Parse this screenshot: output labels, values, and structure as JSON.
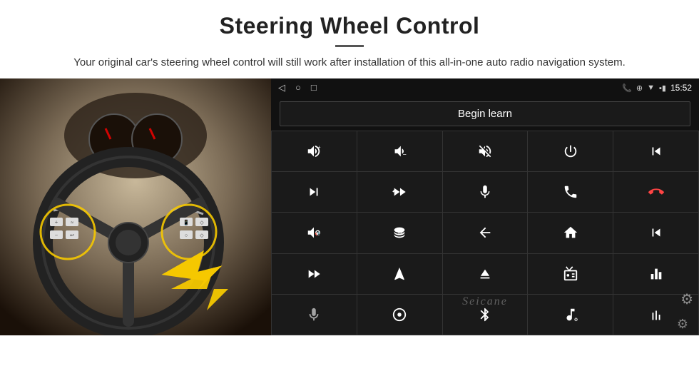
{
  "header": {
    "title": "Steering Wheel Control",
    "subtitle": "Your original car's steering wheel control will still work after installation of this all-in-one auto radio navigation system.",
    "divider": true
  },
  "statusbar": {
    "time": "15:52",
    "nav_icons": [
      "◁",
      "○",
      "□"
    ],
    "right_icons": [
      "📞",
      "⊕",
      "▼"
    ]
  },
  "begin_learn": {
    "label": "Begin learn"
  },
  "controls": [
    {
      "icon": "vol_up",
      "row": 1,
      "col": 1
    },
    {
      "icon": "vol_down",
      "row": 1,
      "col": 2
    },
    {
      "icon": "mute",
      "row": 1,
      "col": 3
    },
    {
      "icon": "power",
      "row": 1,
      "col": 4
    },
    {
      "icon": "prev_track",
      "row": 1,
      "col": 5
    },
    {
      "icon": "next",
      "row": 2,
      "col": 1
    },
    {
      "icon": "skip_fwd",
      "row": 2,
      "col": 2
    },
    {
      "icon": "mic",
      "row": 2,
      "col": 3
    },
    {
      "icon": "phone",
      "row": 2,
      "col": 4
    },
    {
      "icon": "hang_up",
      "row": 2,
      "col": 5
    },
    {
      "icon": "speaker",
      "row": 3,
      "col": 1
    },
    {
      "icon": "360",
      "row": 3,
      "col": 2
    },
    {
      "icon": "back",
      "row": 3,
      "col": 3
    },
    {
      "icon": "home",
      "row": 3,
      "col": 4
    },
    {
      "icon": "rewind",
      "row": 3,
      "col": 5
    },
    {
      "icon": "fast_fwd",
      "row": 4,
      "col": 1
    },
    {
      "icon": "nav",
      "row": 4,
      "col": 2
    },
    {
      "icon": "eject",
      "row": 4,
      "col": 3
    },
    {
      "icon": "radio",
      "row": 4,
      "col": 4
    },
    {
      "icon": "equalizer",
      "row": 4,
      "col": 5
    },
    {
      "icon": "mic2",
      "row": 5,
      "col": 1
    },
    {
      "icon": "settings2",
      "row": 5,
      "col": 2
    },
    {
      "icon": "bluetooth",
      "row": 5,
      "col": 3
    },
    {
      "icon": "music",
      "row": 5,
      "col": 4
    },
    {
      "icon": "eq2",
      "row": 5,
      "col": 5
    }
  ],
  "watermark": {
    "text": "Seicane"
  }
}
